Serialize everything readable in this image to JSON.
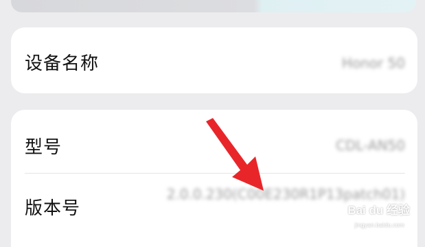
{
  "device_card": {
    "label": "设备名称",
    "value": "Honor 50"
  },
  "info_card": {
    "rows": [
      {
        "label": "型号",
        "value": "CDL-AN50"
      },
      {
        "label": "版本号",
        "value": "2.0.0.230(C00E230R1P13patch01)"
      }
    ]
  },
  "watermark": {
    "text": "Bai du 经验",
    "sub": "jingyan.baidu.com"
  },
  "colors": {
    "background": "#ececee",
    "card": "#ffffff",
    "arrow": "#e8262a"
  }
}
